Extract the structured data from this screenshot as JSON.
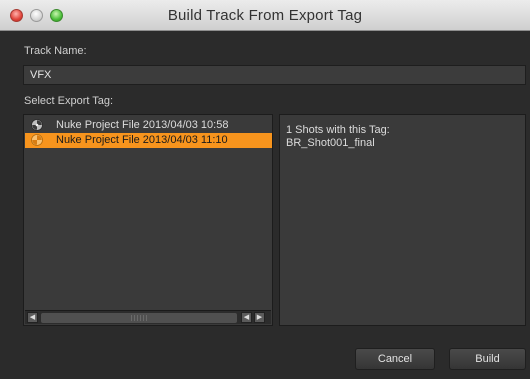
{
  "window": {
    "title": "Build Track From Export Tag"
  },
  "track_name": {
    "label": "Track Name:",
    "value": "VFX"
  },
  "export_tag": {
    "label": "Select Export Tag:",
    "items": [
      {
        "text": "Nuke Project File 2013/04/03 10:58",
        "icon": "nuke-icon",
        "selected": false
      },
      {
        "text": "Nuke Project File 2013/04/03 11:10",
        "icon": "nuke-icon",
        "selected": true
      }
    ]
  },
  "info": {
    "line1": "1 Shots with this Tag:",
    "line2": "BR_Shot001_final"
  },
  "buttons": {
    "cancel": "Cancel",
    "build": "Build"
  },
  "colors": {
    "selection": "#f7941d",
    "background": "#2b2b2b"
  }
}
